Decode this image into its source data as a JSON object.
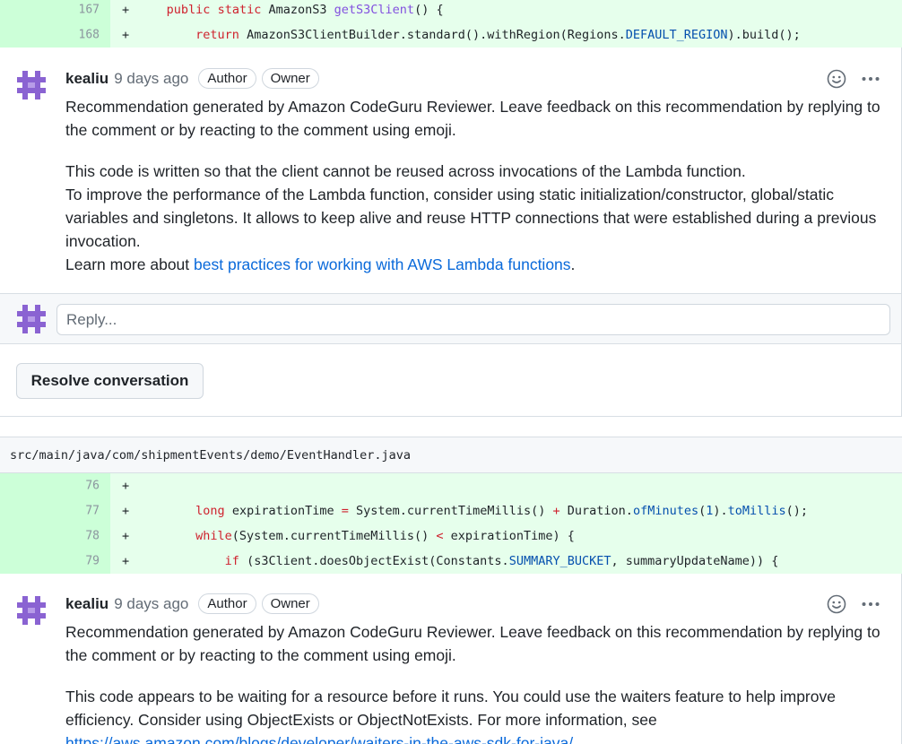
{
  "diff_top": {
    "lines": [
      {
        "num": "167",
        "sign": "+"
      },
      {
        "num": "168",
        "sign": "+"
      }
    ]
  },
  "code_tokens": {
    "l167": {
      "kw1": "public",
      "kw2": "static",
      "type": "AmazonS3",
      "fn": "getS3Client",
      "rest": "() {"
    },
    "l168": {
      "kw": "return",
      "pre": "AmazonS3ClientBuilder.standard().withRegion(Regions.",
      "cst": "DEFAULT_REGION",
      "post": ").build();"
    },
    "l76": {
      "text": ""
    },
    "l77": {
      "kw": "long",
      "a": "expirationTime",
      "eq": "=",
      "b": "System.currentTimeMillis()",
      "plus": "+",
      "c": "Duration.",
      "fn": "ofMinutes",
      "p1": "(",
      "num": "1",
      "p2": ").",
      "fn2": "toMillis",
      "end": "();"
    },
    "l78": {
      "kw": "while",
      "a": "(System.currentTimeMillis()",
      "lt": "<",
      "b": "expirationTime) {"
    },
    "l79": {
      "kw": "if",
      "a": "(s3Client.doesObjectExist(Constants.",
      "cst": "SUMMARY_BUCKET",
      "b": ", summaryUpdateName)) {"
    }
  },
  "comment1": {
    "author": "kealiu",
    "time": "9 days ago",
    "badges": [
      "Author",
      "Owner"
    ],
    "intro": "Recommendation generated by Amazon CodeGuru Reviewer. Leave feedback on this recommendation by replying to the comment or by reacting to the comment using emoji.",
    "line1": "This code is written so that the client cannot be reused across invocations of the Lambda function.",
    "line2": "To improve the performance of the Lambda function, consider using static initialization/constructor, global/static variables and singletons. It allows to keep alive and reuse HTTP connections that were established during a previous invocation.",
    "learn_prefix": "Learn more about ",
    "learn_link": "best practices for working with AWS Lambda functions",
    "learn_suffix": "."
  },
  "reply": {
    "placeholder": "Reply..."
  },
  "resolve_label": "Resolve conversation",
  "file_path": "src/main/java/com/shipmentEvents/demo/EventHandler.java",
  "diff_bottom": {
    "lines": [
      {
        "num": "76",
        "sign": "+"
      },
      {
        "num": "77",
        "sign": "+"
      },
      {
        "num": "78",
        "sign": "+"
      },
      {
        "num": "79",
        "sign": "+"
      }
    ]
  },
  "comment2": {
    "author": "kealiu",
    "time": "9 days ago",
    "badges": [
      "Author",
      "Owner"
    ],
    "intro": "Recommendation generated by Amazon CodeGuru Reviewer. Leave feedback on this recommendation by replying to the comment or by reacting to the comment using emoji.",
    "body": "This code appears to be waiting for a resource before it runs. You could use the waiters feature to help improve efficiency. Consider using ObjectExists or ObjectNotExists. For more information, see",
    "link": "https://aws.amazon.com/blogs/developer/waiters-in-the-aws-sdk-for-java/"
  },
  "icons": {
    "avatar": "identicon-avatar",
    "reaction": "smiley-icon",
    "more": "kebab-horizontal-icon"
  },
  "colors": {
    "addition_bg": "#e6ffec",
    "addition_gutter": "#ccffd8",
    "link": "#0969da",
    "avatar": "#8a63d2"
  }
}
